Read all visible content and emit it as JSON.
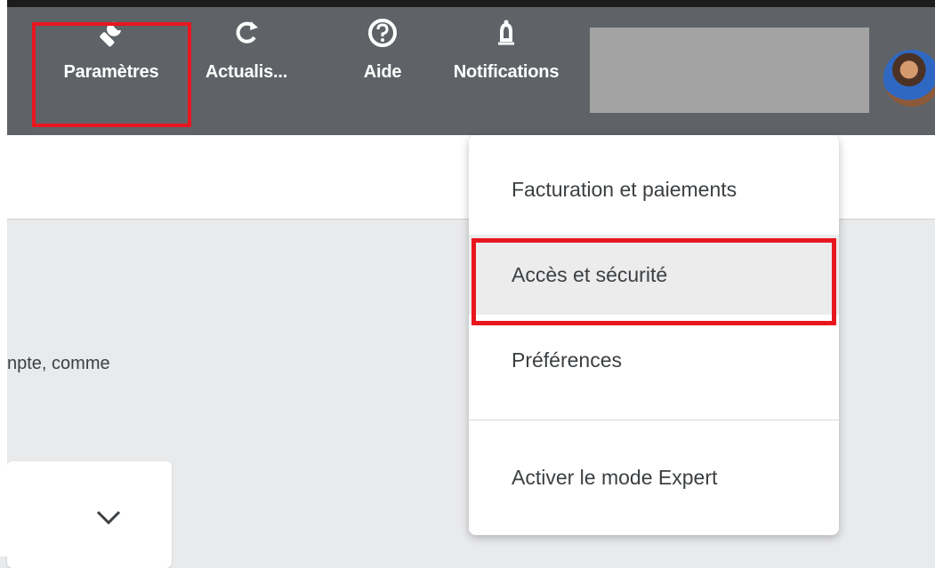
{
  "toolbar": {
    "items": [
      {
        "label": "Paramètres",
        "icon": "wrench-icon"
      },
      {
        "label": "Actualis...",
        "icon": "refresh-icon"
      },
      {
        "label": "Aide",
        "icon": "help-icon"
      },
      {
        "label": "Notifications",
        "icon": "bell-icon"
      }
    ]
  },
  "background": {
    "partial_text": "npte, comme"
  },
  "settings_menu": {
    "items": [
      {
        "label": "Facturation et paiements"
      },
      {
        "label": "Accès et sécurité"
      },
      {
        "label": "Préférences"
      },
      {
        "label": "Activer le mode Expert"
      }
    ]
  },
  "colors": {
    "toolbar_bg": "#5f6368",
    "highlight": "#e8161f",
    "menu_bg": "#ffffff",
    "selected_item_bg": "#ececed"
  }
}
